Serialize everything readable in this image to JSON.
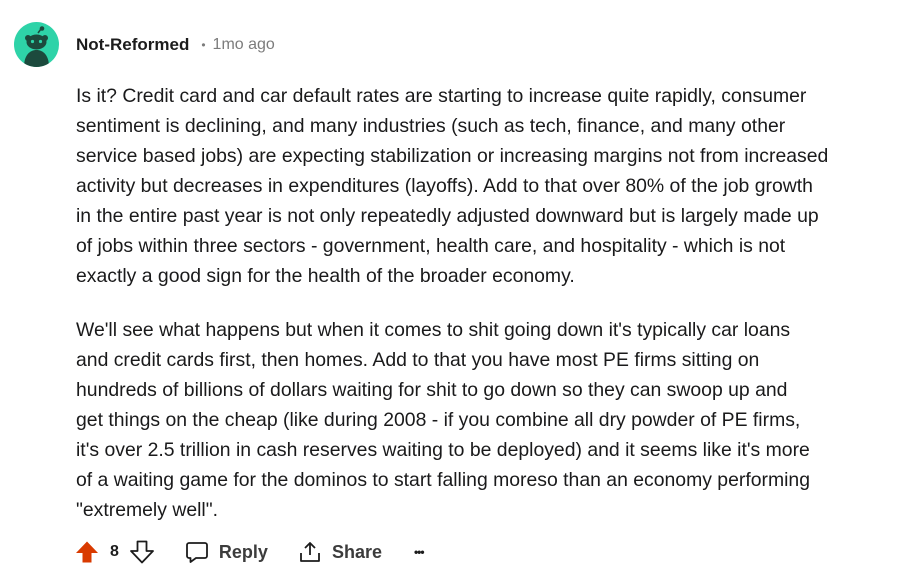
{
  "comment": {
    "author": "Not-Reformed",
    "separator": "•",
    "time": "1mo ago",
    "paragraphs": [
      [
        "Is it? Credit card and car default rates are starting to increase quite rapidly, consumer",
        "sentiment is declining, and many industries (such as tech, finance, and many other",
        "service based jobs) are expecting stabilization or increasing margins not from increased",
        "activity but decreases in expenditures (layoffs). Add to that over 80% of the job growth",
        "in the entire past year is not only repeatedly adjusted downward but is largely made up",
        "of jobs within three sectors - government, health care, and hospitality - which is not",
        "exactly a good sign for the health of the broader economy."
      ],
      [
        "We'll see what happens but when it comes to shit going down it's typically car loans",
        "and credit cards first, then homes. Add to that you have most PE firms sitting on",
        "hundreds of billions of dollars waiting for shit to go down so they can swoop up and",
        "get things on the cheap (like during 2008 - if you combine all dry powder of PE firms,",
        "it's over 2.5 trillion in cash reserves waiting to be deployed) and it seems like it's more",
        "of a waiting game for the dominos to start falling moreso than an economy performing",
        "\"extremely well\"."
      ]
    ]
  },
  "actions": {
    "score": "8",
    "reply_label": "Reply",
    "share_label": "Share",
    "more_label": "•••"
  },
  "colors": {
    "avatar_bg": "#2ed3a8",
    "upvote_active": "#d93a00",
    "meta_gray": "#7c7c7c"
  },
  "icons": {
    "avatar": "snoo-avatar-icon",
    "upvote": "upvote-arrow-icon",
    "downvote": "downvote-arrow-icon",
    "reply": "speech-bubble-icon",
    "share": "share-icon",
    "more": "overflow-menu-icon"
  }
}
